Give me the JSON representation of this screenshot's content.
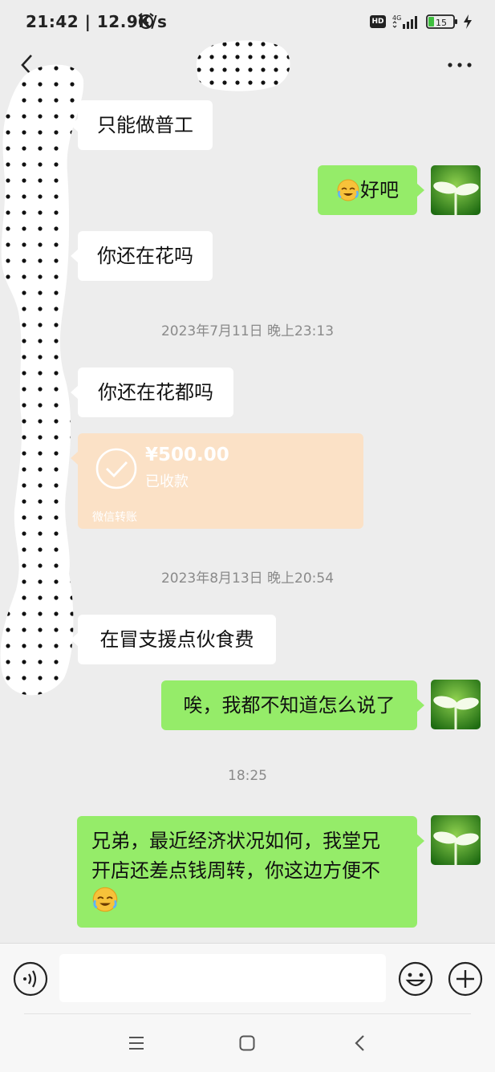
{
  "status_bar": {
    "time": "21:42 | 12.9K/s",
    "network_badge": "HD",
    "network_type": "4G",
    "battery_level": "15",
    "icons": [
      "alarm-icon",
      "hd-icon",
      "signal-icon",
      "battery-icon",
      "charging-icon"
    ]
  },
  "header": {
    "back_icon": "chevron-left-icon",
    "more_icon": "more-dots-icon"
  },
  "messages": [
    {
      "side": "left",
      "text": "只能做普工"
    },
    {
      "side": "right",
      "text": "好吧",
      "emoji": "facepalm-emoji"
    },
    {
      "side": "left",
      "text": "你还在花吗"
    },
    {
      "type": "timestamp",
      "text": "2023年7月11日 晚上23:13"
    },
    {
      "side": "left",
      "text": "你还在花都吗"
    },
    {
      "type": "transfer",
      "amount": "¥500.00",
      "status": "已收款",
      "source": "微信转账"
    },
    {
      "type": "timestamp",
      "text": "2023年8月13日 晚上20:54"
    },
    {
      "side": "left",
      "text": "在冒支援点伙食费"
    },
    {
      "side": "right",
      "text": "唉，我都不知道怎么说了"
    },
    {
      "type": "timestamp",
      "text": "18:25"
    },
    {
      "side": "right",
      "lines": [
        "兄弟，最近经济状况如何，我堂兄",
        "开店还差点钱周转，你这边方便不"
      ],
      "emoji": "facepalm-emoji"
    }
  ],
  "input_bar": {
    "voice_icon": "voice-icon",
    "input_value": "",
    "emoji_icon": "smiley-icon",
    "plus_icon": "plus-icon"
  },
  "colors": {
    "background": "#ededed",
    "bubble_self": "#95ec69",
    "bubble_other": "#ffffff",
    "transfer_card": "#fbe1c6",
    "timestamp_text": "#8a8a8a"
  }
}
